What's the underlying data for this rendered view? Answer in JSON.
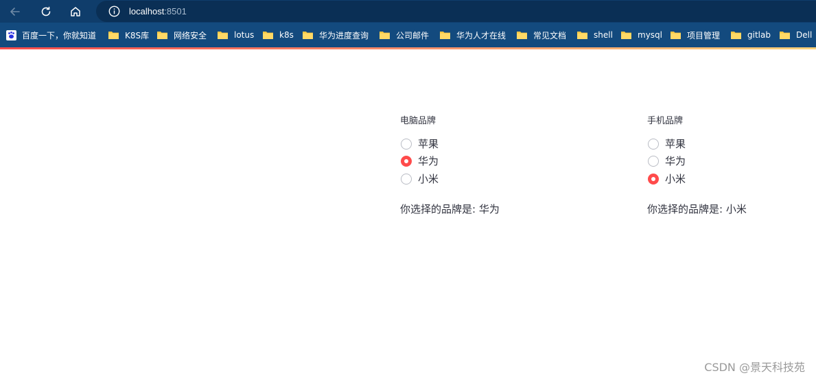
{
  "browser": {
    "url_host": "localhost",
    "url_port": ":8501",
    "bookmarks": [
      {
        "label": "百度一下，你就知道",
        "icon": "baidu-icon"
      },
      {
        "label": "K8S库",
        "icon": "folder-icon"
      },
      {
        "label": "网络安全",
        "icon": "folder-icon"
      },
      {
        "label": "lotus",
        "icon": "folder-icon"
      },
      {
        "label": "k8s",
        "icon": "folder-icon"
      },
      {
        "label": "华为进度查询",
        "icon": "folder-icon"
      },
      {
        "label": "公司邮件",
        "icon": "folder-icon"
      },
      {
        "label": "华为人才在线",
        "icon": "folder-icon"
      },
      {
        "label": "常见文档",
        "icon": "folder-icon"
      },
      {
        "label": "shell",
        "icon": "folder-icon"
      },
      {
        "label": "mysql",
        "icon": "folder-icon"
      },
      {
        "label": "项目管理",
        "icon": "folder-icon"
      },
      {
        "label": "gitlab",
        "icon": "folder-icon"
      },
      {
        "label": "Dell",
        "icon": "folder-icon"
      }
    ]
  },
  "colors": {
    "accent": "#ff4b4b",
    "text": "#31333f",
    "toolbar": "#0f3d6b",
    "bookmarks_bar": "#134a7e"
  },
  "computer": {
    "title": "电脑品牌",
    "options": [
      "苹果",
      "华为",
      "小米"
    ],
    "selected_index": 1,
    "result": "你选择的品牌是: 华为"
  },
  "phone": {
    "title": "手机品牌",
    "options": [
      "苹果",
      "华为",
      "小米"
    ],
    "selected_index": 2,
    "result": "你选择的品牌是: 小米"
  },
  "watermark": "CSDN @景天科技苑"
}
